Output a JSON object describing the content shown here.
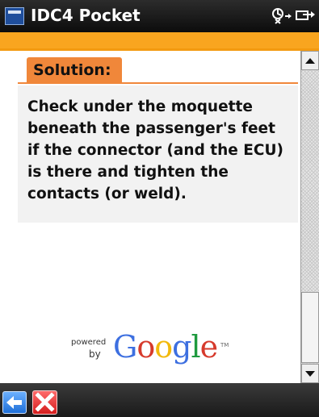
{
  "window": {
    "title": "IDC4 Pocket",
    "app_icon": "app-window-icon",
    "status_icons": [
      "connectivity-icon",
      "sync-icon"
    ]
  },
  "colors": {
    "title_bar": "#111111",
    "accent_strip": "#f9a51f",
    "section_tab": "#f0873a",
    "text_box_bg": "#f2f2f2",
    "google_blue": "#3d6fe0",
    "google_red": "#d63a2c",
    "google_yellow": "#f2b90c",
    "google_green": "#1f9a3f"
  },
  "solution": {
    "heading": "Solution:",
    "text": "Check under the moquette beneath the passenger's feet if the connector (and the ECU) is there and tighten the contacts (or weld)."
  },
  "powered_by": {
    "powered": "powered",
    "by": "by",
    "logo_letters": [
      "G",
      "o",
      "o",
      "g",
      "l",
      "e"
    ],
    "tm": "TM"
  },
  "toolbar": {
    "back_icon": "back-arrow-icon",
    "close_icon": "close-x-icon"
  }
}
